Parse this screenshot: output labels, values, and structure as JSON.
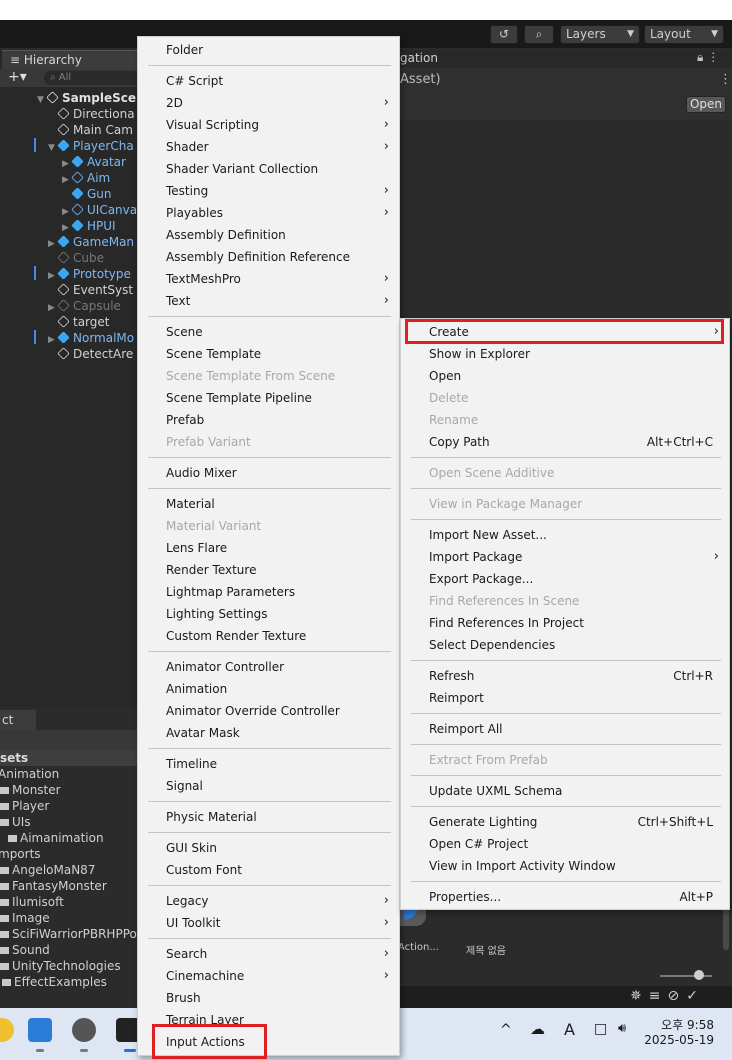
{
  "toolbar": {
    "layers_label": "Layers",
    "layout_label": "Layout"
  },
  "hierarchy": {
    "tab_label": "Hierarchy",
    "search_placeholder": "All",
    "items": [
      {
        "label": "SampleScen",
        "color": "#e0e0e0",
        "bold": true
      },
      {
        "label": "Directiona"
      },
      {
        "label": "Main Cam"
      },
      {
        "label": "PlayerCha",
        "color": "#7cb8f2"
      },
      {
        "label": "Avatar",
        "color": "#7cb8f2"
      },
      {
        "label": "Aim",
        "color": "#7cb8f2"
      },
      {
        "label": "Gun",
        "color": "#7cb8f2"
      },
      {
        "label": "UICanva",
        "color": "#7cb8f2"
      },
      {
        "label": "HPUI",
        "color": "#7cb8f2"
      },
      {
        "label": "GameMan",
        "color": "#7cb8f2"
      },
      {
        "label": "Cube",
        "color": "#777777"
      },
      {
        "label": "Prototype",
        "color": "#7cb8f2"
      },
      {
        "label": "EventSyst"
      },
      {
        "label": "Capsule",
        "color": "#777777"
      },
      {
        "label": "target"
      },
      {
        "label": "NormalMo",
        "color": "#7cb8f2"
      },
      {
        "label": "DetectAre"
      }
    ]
  },
  "inspector": {
    "tab_fragment": "gation",
    "asset_fragment": "Asset)",
    "open_button": "Open"
  },
  "project": {
    "tab_label": "ct",
    "assets_header": "sets",
    "items": [
      {
        "label": "Animation"
      },
      {
        "label": "Monster"
      },
      {
        "label": "Player"
      },
      {
        "label": "UIs"
      },
      {
        "label": "Aimanimation"
      },
      {
        "label": "mports"
      },
      {
        "label": "AngeloMaN87"
      },
      {
        "label": "FantasyMonster"
      },
      {
        "label": "Ilumisoft"
      },
      {
        "label": "Image"
      },
      {
        "label": "SciFiWarriorPBRHPPoly"
      },
      {
        "label": "Sound"
      },
      {
        "label": "UnityTechnologies"
      },
      {
        "label": "EffectExamples"
      }
    ],
    "asset_labels": [
      "Action...",
      "제목 없음"
    ]
  },
  "create_menu": {
    "items": [
      {
        "label": "Folder",
        "submenu": false,
        "disabled": false
      },
      {
        "label": "C# Script",
        "submenu": false,
        "disabled": false
      },
      {
        "label": "2D",
        "submenu": true,
        "disabled": false
      },
      {
        "label": "Visual Scripting",
        "submenu": true,
        "disabled": false
      },
      {
        "label": "Shader",
        "submenu": true,
        "disabled": false
      },
      {
        "label": "Shader Variant Collection",
        "submenu": false,
        "disabled": false
      },
      {
        "label": "Testing",
        "submenu": true,
        "disabled": false
      },
      {
        "label": "Playables",
        "submenu": true,
        "disabled": false
      },
      {
        "label": "Assembly Definition",
        "submenu": false,
        "disabled": false
      },
      {
        "label": "Assembly Definition Reference",
        "submenu": false,
        "disabled": false
      },
      {
        "label": "TextMeshPro",
        "submenu": true,
        "disabled": false
      },
      {
        "label": "Text",
        "submenu": true,
        "disabled": false
      },
      {
        "label": "Scene",
        "submenu": false,
        "disabled": false
      },
      {
        "label": "Scene Template",
        "submenu": false,
        "disabled": false
      },
      {
        "label": "Scene Template From Scene",
        "submenu": false,
        "disabled": true
      },
      {
        "label": "Scene Template Pipeline",
        "submenu": false,
        "disabled": false
      },
      {
        "label": "Prefab",
        "submenu": false,
        "disabled": false
      },
      {
        "label": "Prefab Variant",
        "submenu": false,
        "disabled": true
      },
      {
        "label": "Audio Mixer",
        "submenu": false,
        "disabled": false
      },
      {
        "label": "Material",
        "submenu": false,
        "disabled": false
      },
      {
        "label": "Material Variant",
        "submenu": false,
        "disabled": true
      },
      {
        "label": "Lens Flare",
        "submenu": false,
        "disabled": false
      },
      {
        "label": "Render Texture",
        "submenu": false,
        "disabled": false
      },
      {
        "label": "Lightmap Parameters",
        "submenu": false,
        "disabled": false
      },
      {
        "label": "Lighting Settings",
        "submenu": false,
        "disabled": false
      },
      {
        "label": "Custom Render Texture",
        "submenu": false,
        "disabled": false
      },
      {
        "label": "Animator Controller",
        "submenu": false,
        "disabled": false
      },
      {
        "label": "Animation",
        "submenu": false,
        "disabled": false
      },
      {
        "label": "Animator Override Controller",
        "submenu": false,
        "disabled": false
      },
      {
        "label": "Avatar Mask",
        "submenu": false,
        "disabled": false
      },
      {
        "label": "Timeline",
        "submenu": false,
        "disabled": false
      },
      {
        "label": "Signal",
        "submenu": false,
        "disabled": false
      },
      {
        "label": "Physic Material",
        "submenu": false,
        "disabled": false
      },
      {
        "label": "GUI Skin",
        "submenu": false,
        "disabled": false
      },
      {
        "label": "Custom Font",
        "submenu": false,
        "disabled": false
      },
      {
        "label": "Legacy",
        "submenu": true,
        "disabled": false
      },
      {
        "label": "UI Toolkit",
        "submenu": true,
        "disabled": false
      },
      {
        "label": "Search",
        "submenu": true,
        "disabled": false
      },
      {
        "label": "Cinemachine",
        "submenu": true,
        "disabled": false
      },
      {
        "label": "Brush",
        "submenu": false,
        "disabled": false
      },
      {
        "label": "Terrain Layer",
        "submenu": false,
        "disabled": false
      },
      {
        "label": "Input Actions",
        "submenu": false,
        "disabled": false,
        "highlighted": true
      }
    ]
  },
  "context_menu": {
    "items": [
      {
        "label": "Create",
        "submenu": true,
        "disabled": false,
        "highlighted": true
      },
      {
        "label": "Show in Explorer",
        "disabled": false
      },
      {
        "label": "Open",
        "disabled": false
      },
      {
        "label": "Delete",
        "disabled": true
      },
      {
        "label": "Rename",
        "disabled": true
      },
      {
        "label": "Copy Path",
        "shortcut": "Alt+Ctrl+C",
        "disabled": false
      },
      {
        "label": "Open Scene Additive",
        "disabled": true
      },
      {
        "label": "View in Package Manager",
        "disabled": true
      },
      {
        "label": "Import New Asset...",
        "disabled": false
      },
      {
        "label": "Import Package",
        "submenu": true,
        "disabled": false
      },
      {
        "label": "Export Package...",
        "disabled": false
      },
      {
        "label": "Find References In Scene",
        "disabled": true
      },
      {
        "label": "Find References In Project",
        "disabled": false
      },
      {
        "label": "Select Dependencies",
        "disabled": false
      },
      {
        "label": "Refresh",
        "shortcut": "Ctrl+R",
        "disabled": false
      },
      {
        "label": "Reimport",
        "disabled": false
      },
      {
        "label": "Reimport All",
        "disabled": false
      },
      {
        "label": "Extract From Prefab",
        "disabled": true
      },
      {
        "label": "Update UXML Schema",
        "disabled": false
      },
      {
        "label": "Generate Lighting",
        "shortcut": "Ctrl+Shift+L",
        "disabled": false
      },
      {
        "label": "Open C# Project",
        "disabled": false
      },
      {
        "label": "View in Import Activity Window",
        "disabled": false
      },
      {
        "label": "Properties...",
        "shortcut": "Alt+P",
        "disabled": false
      }
    ]
  },
  "taskbar": {
    "time": "오후 9:58",
    "date": "2025-05-19",
    "ime_label": "A"
  },
  "colors": {
    "highlight_border": "#e02020",
    "menu_bg": "#f2f2f2",
    "unity_blue": "#7cb8f2"
  }
}
